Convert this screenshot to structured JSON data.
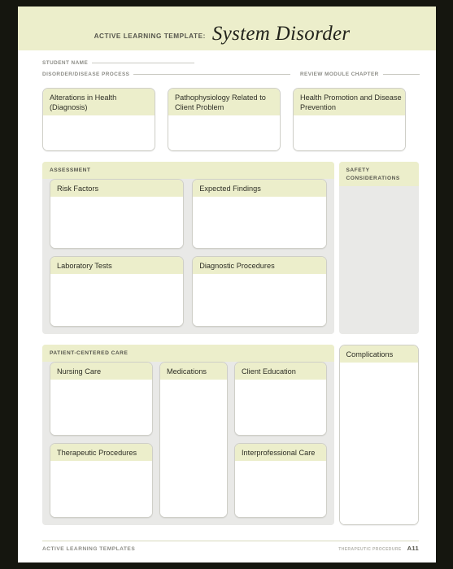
{
  "document": {
    "header": {
      "eyebrow": "ACTIVE LEARNING TEMPLATE:",
      "title": "System Disorder"
    },
    "meta_fields": [
      {
        "label": "STUDENT NAME",
        "value": ""
      },
      {
        "label": "DISORDER/DISEASE PROCESS",
        "value": ""
      },
      {
        "label": "REVIEW MODULE CHAPTER",
        "value": ""
      }
    ],
    "top_boxes": [
      {
        "title": "Alterations in Health (Diagnosis)",
        "value": ""
      },
      {
        "title": "Pathophysiology Related to Client Problem",
        "value": ""
      },
      {
        "title": "Health Promotion and Disease Prevention",
        "value": ""
      }
    ],
    "assessment": {
      "section_title": "ASSESSMENT",
      "boxes": [
        {
          "title": "Risk Factors",
          "value": ""
        },
        {
          "title": "Expected Findings",
          "value": ""
        },
        {
          "title": "Laboratory Tests",
          "value": ""
        },
        {
          "title": "Diagnostic Procedures",
          "value": ""
        }
      ]
    },
    "safety": {
      "section_title": "SAFETY CONSIDERATIONS",
      "value": ""
    },
    "patient_centered_care": {
      "section_title": "PATIENT-CENTERED CARE",
      "boxes": [
        {
          "title": "Nursing Care",
          "value": ""
        },
        {
          "title": "Medications",
          "value": ""
        },
        {
          "title": "Client Education",
          "value": ""
        },
        {
          "title": "Therapeutic Procedures",
          "value": ""
        },
        {
          "title": "Interprofessional Care",
          "value": ""
        }
      ]
    },
    "complications": {
      "title": "Complications",
      "value": ""
    },
    "footer": {
      "left": "ACTIVE LEARNING TEMPLATES",
      "category": "THERAPEUTIC PROCEDURE",
      "page": "A11"
    },
    "colors": {
      "band": "#ECEECB",
      "panel_body": "#E9E9E7",
      "box_border": "#CFCFC8",
      "page": "#FFFFFF",
      "frame": "#15160F",
      "label_text": "#8C8C86",
      "body_text": "#2E2F26"
    }
  }
}
